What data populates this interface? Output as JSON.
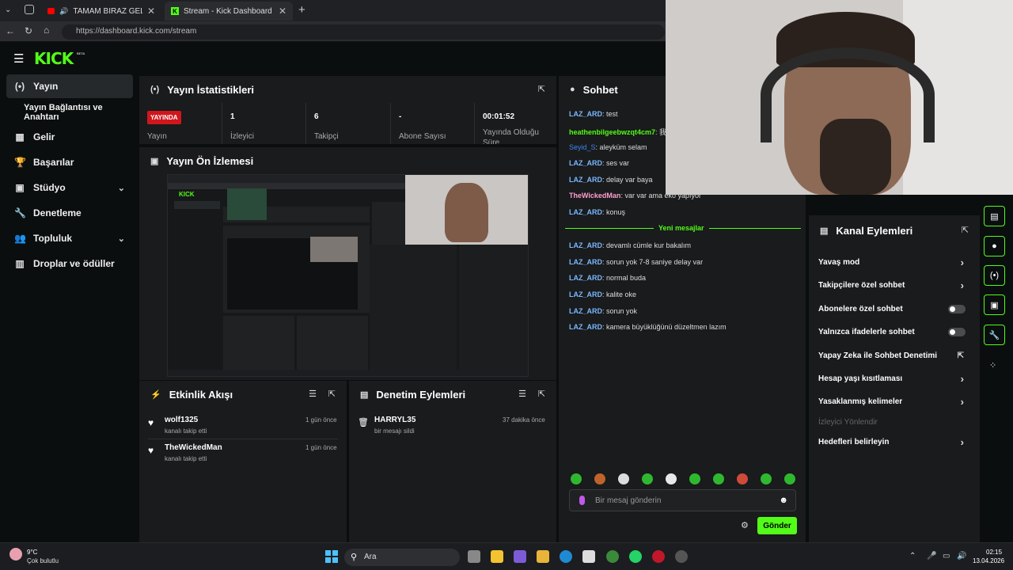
{
  "browser": {
    "tabs": [
      {
        "title": "TAMAM BIRAZ GELİŞMİŞ FAK"
      },
      {
        "title": "Stream - Kick Dashboard"
      }
    ],
    "url": "https://dashboard.kick.com/stream"
  },
  "brand": {
    "logo": "KICK",
    "beta": "BETA",
    "accent": "#53fc18"
  },
  "sidebar": {
    "items": [
      {
        "label": "Yayın",
        "icon": "broadcast-icon"
      },
      {
        "label": "Yayın Bağlantısı ve Anahtarı"
      },
      {
        "label": "Gelir",
        "icon": "revenue-icon"
      },
      {
        "label": "Başarılar",
        "icon": "trophy-icon"
      },
      {
        "label": "Stüdyo",
        "icon": "studio-icon"
      },
      {
        "label": "Denetleme",
        "icon": "wrench-icon"
      },
      {
        "label": "Topluluk",
        "icon": "community-icon"
      },
      {
        "label": "Droplar ve ödüller",
        "icon": "drops-icon"
      }
    ]
  },
  "stats": {
    "title": "Yayın İstatistikleri",
    "live_badge": "YAYINDA",
    "live_label": "Yayın",
    "cells": [
      {
        "value": "1",
        "label": "İzleyici"
      },
      {
        "value": "6",
        "label": "Takipçi"
      },
      {
        "value": "-",
        "label": "Abone Sayısı"
      },
      {
        "value": "00:01:52",
        "label": "Yayında Olduğu Süre"
      }
    ]
  },
  "preview": {
    "title": "Yayın Ön İzlemesi"
  },
  "activity": {
    "title": "Etkinlik Akışı",
    "items": [
      {
        "name": "wolf1325",
        "sub": "kanalı takip etti",
        "time": "1 gün önce"
      },
      {
        "name": "TheWickedMan",
        "sub": "kanalı takip etti",
        "time": "1 gün önce"
      }
    ]
  },
  "moderation": {
    "title": "Denetim Eylemleri",
    "items": [
      {
        "name": "HARRYL35",
        "sub": "bir mesajı sildi",
        "time": "37 dakika önce"
      }
    ]
  },
  "chat": {
    "title": "Sohbet",
    "messages": [
      {
        "user": "LAZ_ARD",
        "text": ": test",
        "color": "#7ab8ff"
      },
      {
        "user": "heathenbilgeebwzqt4cm7",
        "text": ": 我",
        "color": "#53fc18"
      },
      {
        "user": "Seyid_S",
        "text": ": aleyküm selam",
        "color": "#3d86f0"
      },
      {
        "user": "LAZ_ARD",
        "text": ": ses var",
        "color": "#7ab8ff"
      },
      {
        "user": "LAZ_ARD",
        "text": ": delay var baya",
        "color": "#7ab8ff"
      },
      {
        "user": "TheWickedMan",
        "text": ": var var ama eko yapıyor",
        "color": "#ff9fd0"
      },
      {
        "user": "LAZ_ARD",
        "text": ": konuş",
        "color": "#7ab8ff"
      }
    ],
    "new_divider": "Yeni mesajlar",
    "new_messages": [
      {
        "user": "LAZ_ARD",
        "text": ": devamlı cümle kur bakalım"
      },
      {
        "user": "LAZ_ARD",
        "text": ": sorun yok 7-8 saniye delay var"
      },
      {
        "user": "LAZ_ARD",
        "text": ": normal buda"
      },
      {
        "user": "LAZ_ARD",
        "text": ": kalite oke"
      },
      {
        "user": "LAZ_ARD",
        "text": ": sorun yok"
      },
      {
        "user": "LAZ_ARD",
        "text": ": kamera büyüklüğünü düzeltmen lazım"
      }
    ],
    "input_placeholder": "Bir mesaj gönderin",
    "send_label": "Gönder"
  },
  "channel_actions": {
    "title": "Kanal Eylemleri",
    "items": [
      {
        "label": "Yavaş mod",
        "control": "arrow"
      },
      {
        "label": "Takipçilere özel sohbet",
        "control": "arrow"
      },
      {
        "label": "Abonelere özel sohbet",
        "control": "toggle"
      },
      {
        "label": "Yalnızca ifadelerle sohbet",
        "control": "toggle"
      },
      {
        "label": "Yapay Zeka ile Sohbet Denetimi",
        "control": "external"
      },
      {
        "label": "Hesap yaşı kısıtlaması",
        "control": "arrow"
      },
      {
        "label": "Yasaklanmış kelimeler",
        "control": "arrow"
      },
      {
        "label": "İzleyici Yönlendir",
        "control": "none"
      },
      {
        "label": "Hedefleri belirleyin",
        "control": "arrow"
      }
    ]
  },
  "taskbar": {
    "weather_temp": "9°C",
    "weather_desc": "Çok bulutlu",
    "search": "Ara",
    "time": "02:15",
    "date": "13.04.2026"
  }
}
